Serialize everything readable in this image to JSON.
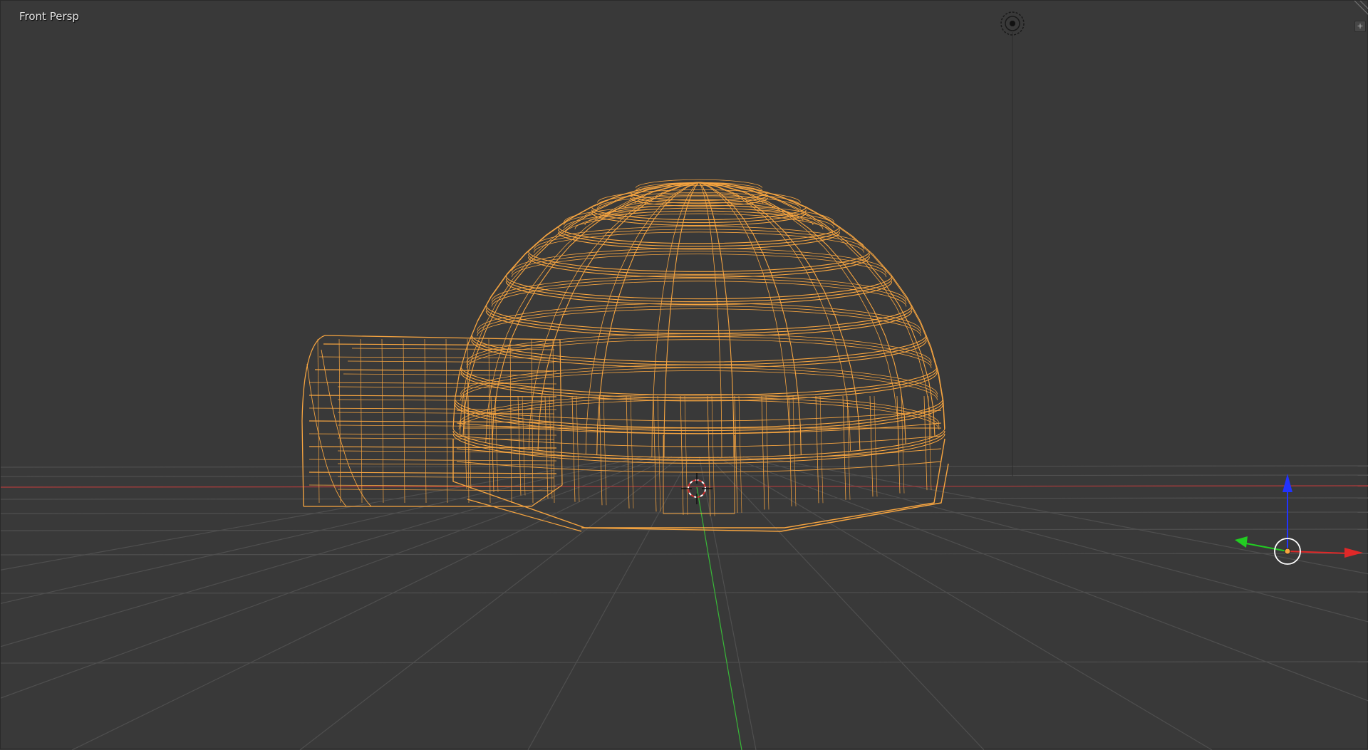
{
  "viewport": {
    "view_label": "Front Persp",
    "shading": "wireframe",
    "background_color": "#393939",
    "selection_color": "#f7a540",
    "grid_color": "#505050",
    "axis_x_color": "#d23a3a",
    "axis_y_color": "#3ec73e",
    "axis_z_color": "#2a3cff",
    "selected_object": "igloo"
  },
  "icons": {
    "camera_light": "light-lamp-icon",
    "cursor": "3d-cursor-icon",
    "gizmo": "transform-manipulator-icon",
    "panel_toggle": "plus-icon",
    "corner": "area-split-corner-icon"
  },
  "panel_toggle_glyph": "+"
}
